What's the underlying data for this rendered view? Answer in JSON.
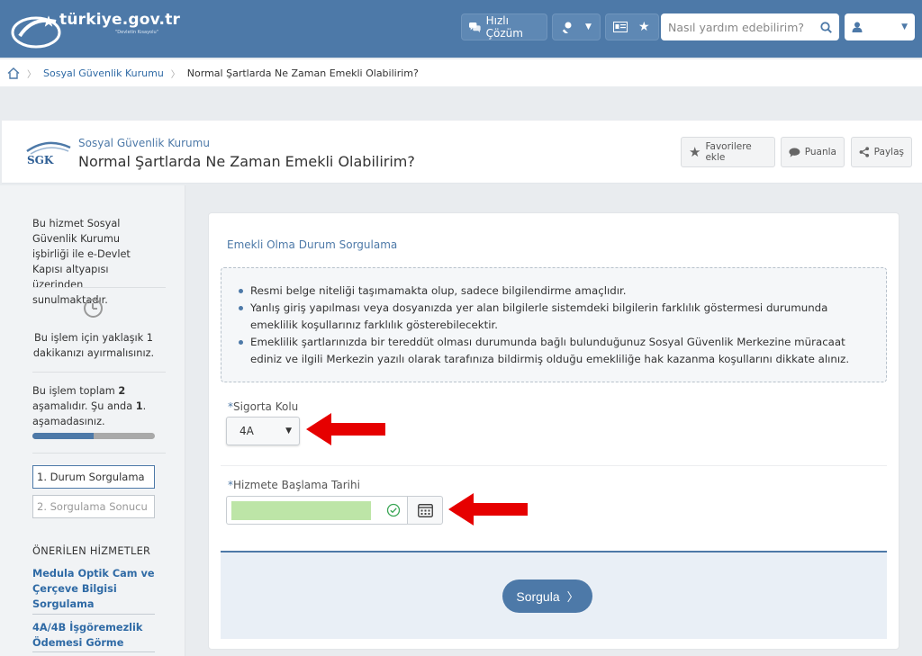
{
  "header": {
    "logo_text": "türkiye.gov.tr",
    "logo_sub": "\"Devletin Kısayolu\"",
    "quick_solution_label": "Hızlı Çözüm",
    "search_placeholder": "Nasıl yardım edebilirim?"
  },
  "breadcrumb": {
    "items": [
      "Sosyal Güvenlik Kurumu"
    ],
    "current": "Normal Şartlarda Ne Zaman Emekli Olabilirim?"
  },
  "service": {
    "logo_text": "SGK",
    "org": "Sosyal Güvenlik Kurumu",
    "title": "Normal Şartlarda Ne Zaman Emekli Olabilirim?",
    "actions": {
      "favorite": "Favorilere ekle",
      "rate": "Puanla",
      "share": "Paylaş"
    }
  },
  "sidebar": {
    "info1": "Bu hizmet Sosyal Güvenlik Kurumu işbirliği ile e-Devlet Kapısı altyapısı üzerinden sunulmaktadır.",
    "info2": "Bu işlem için yaklaşık 1 dakikanızı ayırmalısınız.",
    "info3_prefix": "Bu işlem toplam ",
    "info3_total": "2",
    "info3_middle": " aşamalıdır. Şu anda ",
    "info3_current": "1",
    "info3_suffix": ". aşamadasınız.",
    "progress": 0.5,
    "steps": [
      "1. Durum Sorgulama",
      "2. Sorgulama Sonucu"
    ],
    "recommended_heading": "ÖNERİLEN HİZMETLER",
    "recommended": [
      "Medula Optik Cam ve Çerçeve Bilgisi Sorgulama",
      "4A/4B İşgöremezlik Ödemesi Görme"
    ]
  },
  "form": {
    "title": "Emekli Olma Durum Sorgulama",
    "notes": [
      "Resmi belge niteliği taşımamakta olup, sadece bilgilendirme amaçlıdır.",
      "Yanlış giriş yapılması veya dosyanızda yer alan bilgilerle sistemdeki bilgilerin farklılık göstermesi durumunda emeklilik koşullarınız farklılık gösterebilecektir.",
      "Emeklilik şartlarınızda bir tereddüt olması durumunda bağlı bulunduğunuz Sosyal Güvenlik Merkezine müracaat ediniz ve ilgili Merkezin yazılı olarak tarafınıza bildirmiş olduğu emekliliğe hak kazanma koşullarını dikkate alınız."
    ],
    "required_mark": "*",
    "insurance_label": "Sigorta Kolu",
    "insurance_value": "4A",
    "start_date_label": "Hizmete Başlama Tarihi",
    "submit_label": "Sorgula"
  },
  "colors": {
    "primary": "#4d79a8",
    "arrow": "#e60000",
    "date_fill": "#bde5a7"
  }
}
